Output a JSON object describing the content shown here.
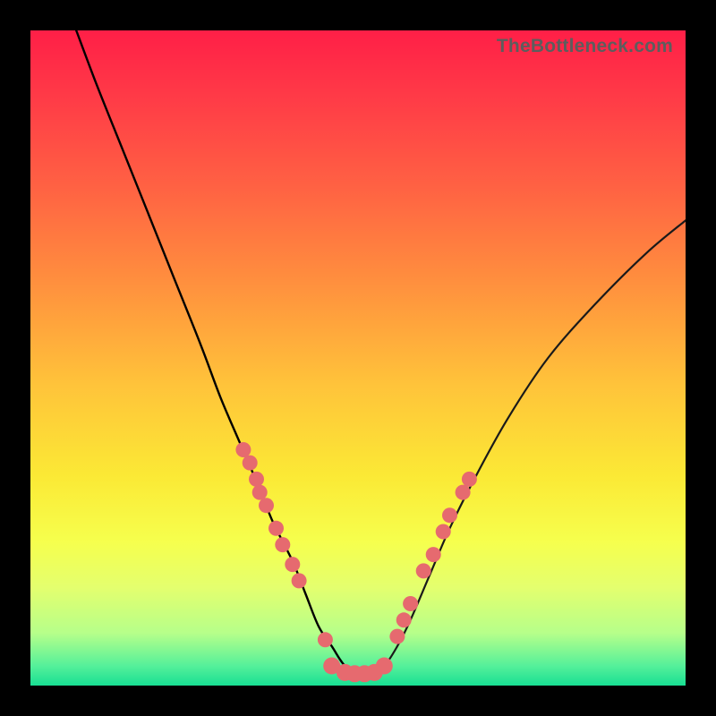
{
  "attribution": "TheBottleneck.com",
  "chart_data": {
    "type": "line",
    "title": "",
    "xlabel": "",
    "ylabel": "",
    "xlim": [
      0,
      100
    ],
    "ylim": [
      0,
      100
    ],
    "series": [
      {
        "name": "curve",
        "color": "#000000",
        "x": [
          7,
          10,
          14,
          18,
          22,
          26,
          29,
          32,
          35,
          37,
          40,
          42,
          44,
          46,
          48,
          50,
          52,
          54,
          56,
          58,
          61,
          64,
          68,
          73,
          79,
          86,
          94,
          100
        ],
        "y": [
          100,
          92,
          82,
          72,
          62,
          52,
          44,
          37,
          30,
          25,
          19,
          14,
          9,
          6,
          3,
          2,
          2,
          3,
          6,
          10,
          17,
          24,
          32,
          41,
          50,
          58,
          66,
          71
        ]
      },
      {
        "name": "left-dots",
        "color": "#e66a6f",
        "type": "scatter",
        "x": [
          32.5,
          33.5,
          34.5,
          35.0,
          36.0,
          37.5,
          38.5,
          40.0,
          41.0,
          45.0
        ],
        "y": [
          36.0,
          34.0,
          31.5,
          29.5,
          27.5,
          24.0,
          21.5,
          18.5,
          16.0,
          7.0
        ]
      },
      {
        "name": "right-dots",
        "color": "#e66a6f",
        "type": "scatter",
        "x": [
          56.0,
          57.0,
          58.0,
          60.0,
          61.5,
          63.0,
          64.0,
          66.0,
          67.0
        ],
        "y": [
          7.5,
          10.0,
          12.5,
          17.5,
          20.0,
          23.5,
          26.0,
          29.5,
          31.5
        ]
      },
      {
        "name": "bottom-dots",
        "color": "#e66a6f",
        "type": "scatter",
        "x": [
          46.0,
          48.0,
          49.5,
          51.0,
          52.5,
          54.0
        ],
        "y": [
          3.0,
          2.0,
          1.8,
          1.8,
          2.0,
          3.0
        ]
      }
    ]
  },
  "colors": {
    "dot_fill": "#e66a6f",
    "curve_left": "#000000",
    "curve_right": "#1a1a1a"
  }
}
